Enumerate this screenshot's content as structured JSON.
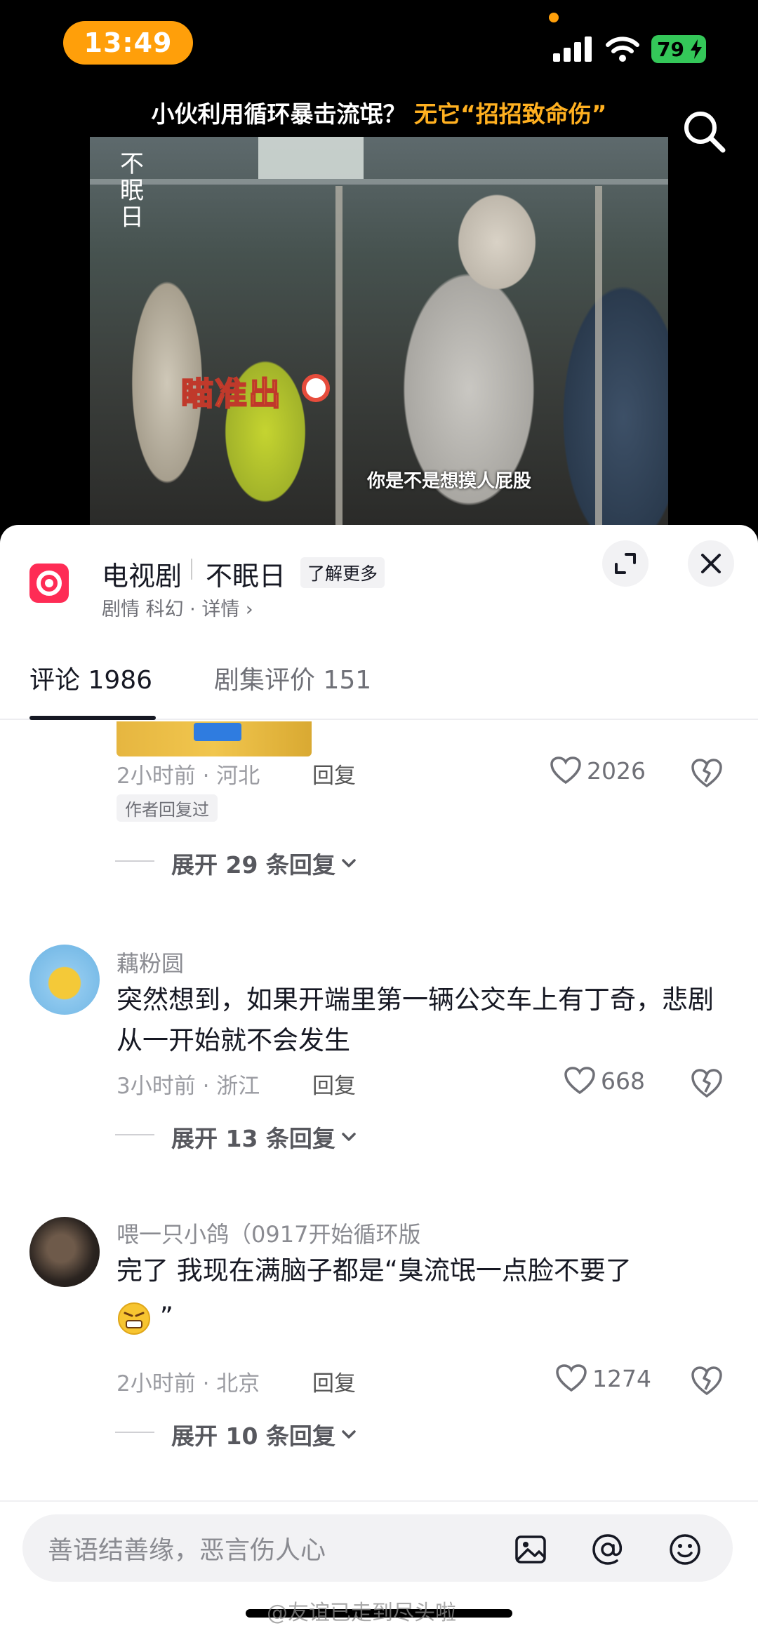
{
  "status_bar": {
    "time": "13:49",
    "battery": "79"
  },
  "video": {
    "title_plain": "小伙利用循环暴击流氓？",
    "title_highlight": "无它“招招致命伤”",
    "watermark": "不眠日",
    "sticker": "瞄准出",
    "subtitle": "你是不是想摸人屁股"
  },
  "drama": {
    "type": "电视剧",
    "name": "不眠日",
    "learn_more": "了解更多",
    "meta": "剧情 科幻 · 详情 ›"
  },
  "tabs": [
    {
      "label": "评论 1986"
    },
    {
      "label": "剧集评价 151"
    }
  ],
  "comments": [
    {
      "meta": "2小时前 · 河北",
      "reply": "回复",
      "likes": "2026",
      "badge": "作者回复过",
      "expand": "展开 29 条回复"
    },
    {
      "username": "藕粉圆",
      "text": "突然想到，如果开端里第一辆公交车上有丁奇，悲剧从一开始就不会发生",
      "meta": "3小时前 · 浙江",
      "reply": "回复",
      "likes": "668",
      "expand": "展开 13 条回复"
    },
    {
      "username": "喂一只小鸽（0917开始循环版",
      "text": "完了 我现在满脑子都是“臭流氓一点脸不要了",
      "text_tail": "”",
      "meta": "2小时前 · 北京",
      "reply": "回复",
      "likes": "1274",
      "expand": "展开 10 条回复"
    }
  ],
  "input": {
    "placeholder": "善语结善缘，恶言伤人心"
  },
  "watermark_bottom": "@友谊已走到尽头啦",
  "colors": {
    "accent": "#fe2c55",
    "status_pill": "#ff9f0a",
    "battery": "#34c759",
    "title_highlight": "#ffb020"
  }
}
